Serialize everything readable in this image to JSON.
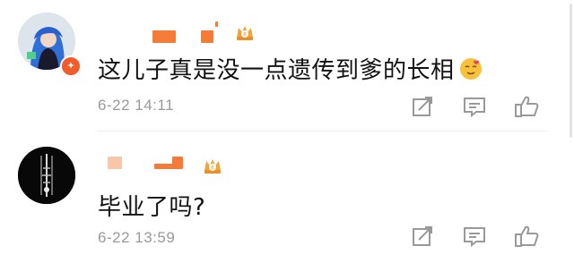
{
  "comments": [
    {
      "text": "这儿子真是没一点遗传到爹的长相",
      "timestamp": "6-22 14:11",
      "verified": true,
      "emoji": "face-with-hearts",
      "crown_icon": "vip-crown-icon",
      "crown_level": "6"
    },
    {
      "text": "毕业了吗?",
      "timestamp": "6-22 13:59",
      "verified": false,
      "crown_icon": "vip-crown-icon",
      "crown_level": "6"
    }
  ],
  "actions": {
    "share_icon": "share-icon",
    "comment_icon": "comment-icon",
    "like_icon": "thumbs-up-icon"
  },
  "colors": {
    "redaction": "#f57b36",
    "redaction_light": "#f7c7a8",
    "timestamp": "#9a9a9a",
    "verify_badge": "#f25b2a",
    "crown": "#f2a43a"
  }
}
